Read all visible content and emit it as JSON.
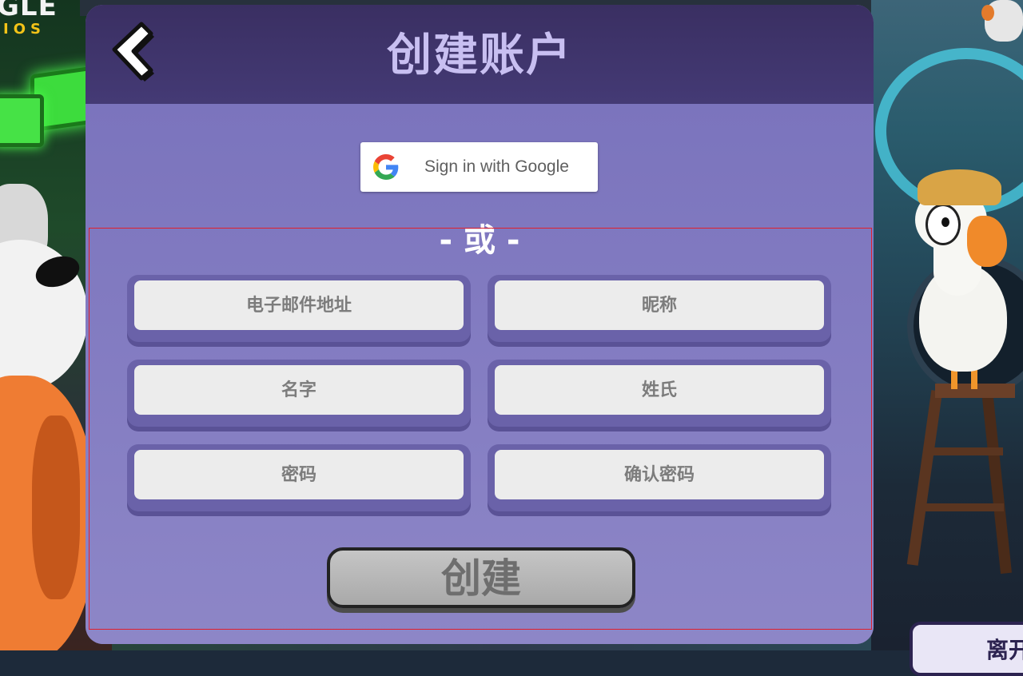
{
  "background": {
    "logo_text": "GLE",
    "logo_sub": "IOS",
    "leave_button_label": "离开"
  },
  "modal": {
    "title": "创建账户",
    "back_icon": "chevron-left-icon",
    "google_button": {
      "icon": "google-g-icon",
      "label": "Sign in with Google"
    },
    "divider_text": "- 或 -",
    "fields": {
      "email_placeholder": "电子邮件地址",
      "nickname_placeholder": "昵称",
      "first_name_placeholder": "名字",
      "last_name_placeholder": "姓氏",
      "password_placeholder": "密码",
      "confirm_password_placeholder": "确认密码"
    },
    "create_button_label": "创建"
  },
  "colors": {
    "modal_header": "#3a2f62",
    "modal_body": "#8b83c6",
    "title_text": "#c8bff1",
    "input_bg": "#ececec",
    "create_button": "#b8b8b8",
    "focus_outline": "#e0202c"
  }
}
